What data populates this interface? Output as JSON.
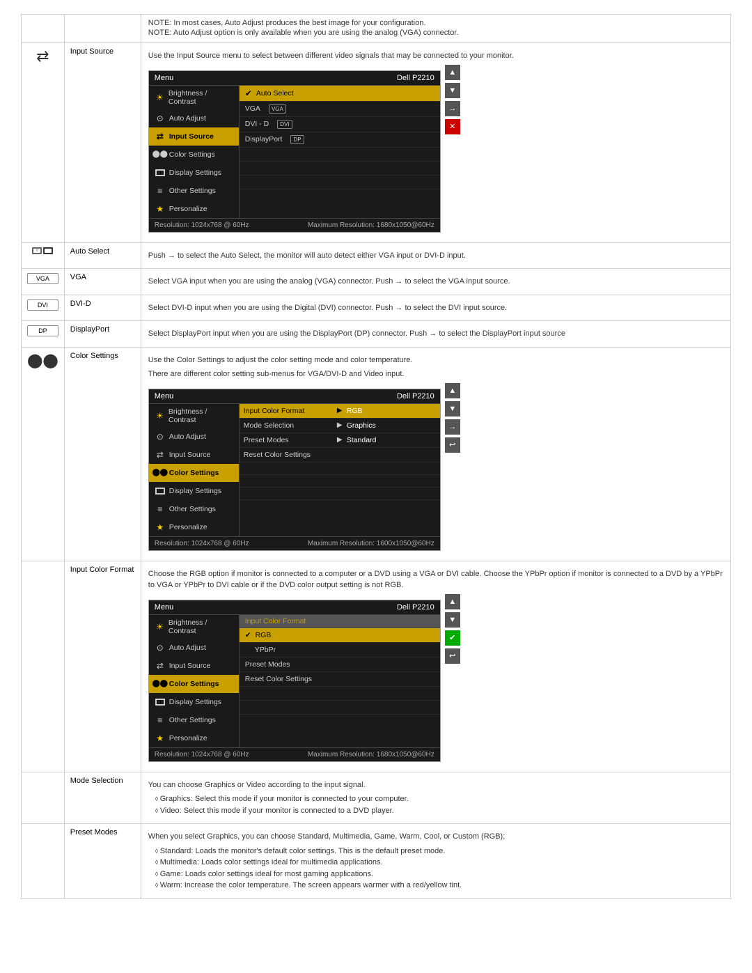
{
  "notes": {
    "note1": "NOTE: In most cases, Auto Adjust produces the best image for your configuration.",
    "note2": "NOTE: Auto Adjust option is only available when you are using the analog (VGA) connector."
  },
  "inputSource": {
    "label": "Input Source",
    "description": "Use the Input Source menu to select between different video signals that may be connected to your monitor.",
    "osd1": {
      "menuLabel": "Menu",
      "brandLabel": "Dell P2210",
      "items": [
        {
          "icon": "☀",
          "label": "Brightness / Contrast"
        },
        {
          "icon": "⊙",
          "label": "Auto Adjust"
        },
        {
          "icon": "⇄",
          "label": "Input Source",
          "active": true
        },
        {
          "icon": "⬤⬤",
          "label": "Color Settings"
        },
        {
          "icon": "▭",
          "label": "Display Settings"
        },
        {
          "icon": "≡",
          "label": "Other Settings"
        },
        {
          "icon": "★",
          "label": "Personalize"
        }
      ],
      "rightItems": [
        {
          "label": "Auto Select",
          "check": "✔",
          "checked": true
        },
        {
          "label": "VGA",
          "connector": "VGA"
        },
        {
          "label": "DVI - D",
          "connector": "DVI"
        },
        {
          "label": "DisplayPort",
          "connector": "DP"
        }
      ],
      "footer": {
        "left": "Resolution: 1024x768 @ 60Hz",
        "right": "Maximum Resolution: 1680x1050@60Hz"
      }
    },
    "navButtons": [
      "▲",
      "▼",
      "→",
      "✕"
    ],
    "navColors": [
      "gray",
      "gray",
      "gray",
      "red"
    ]
  },
  "autoSelect": {
    "label": "Auto Select",
    "description": "Push → to select the Auto Select, the monitor will auto detect either VGA input or DVI-D input."
  },
  "vga": {
    "label": "VGA",
    "description": "Select VGA input when you are using the analog (VGA) connector. Push → to select the VGA input source."
  },
  "dviD": {
    "label": "DVI-D",
    "description": "Select DVI-D input when you are using the Digital (DVI) connector. Push → to select the DVI input source."
  },
  "displayPort": {
    "label": "DisplayPort",
    "description": "Select DisplayPort input when you are using the DisplayPort (DP) connector. Push → to select the DisplayPort input source"
  },
  "colorSettings": {
    "label": "Color Settings",
    "desc1": "Use the Color Settings to adjust the color setting mode and color temperature.",
    "desc2": "There are different color setting sub-menus for VGA/DVI-D and Video input.",
    "osd": {
      "menuLabel": "Menu",
      "brandLabel": "Dell P2210",
      "items": [
        {
          "icon": "☀",
          "label": "Brightness / Contrast"
        },
        {
          "icon": "⊙",
          "label": "Auto Adjust"
        },
        {
          "icon": "⇄",
          "label": "Input Source"
        },
        {
          "icon": "⬤⬤",
          "label": "Color Settings",
          "active": true
        },
        {
          "icon": "▭",
          "label": "Display Settings"
        },
        {
          "icon": "≡",
          "label": "Other Settings"
        },
        {
          "icon": "★",
          "label": "Personalize"
        }
      ],
      "rightRows": [
        {
          "label": "Input Color Format",
          "hasArrow": true,
          "value": "RGB",
          "highlighted": true
        },
        {
          "label": "Mode Selection",
          "hasArrow": true,
          "value": "Graphics"
        },
        {
          "label": "Preset Modes",
          "hasArrow": true,
          "value": "Standard"
        },
        {
          "label": "Reset Color Settings",
          "hasArrow": false,
          "value": ""
        }
      ],
      "footer": {
        "left": "Resolution: 1024x768 @ 60Hz",
        "right": "Maximum Resolution: 1600x1050@60Hz"
      }
    },
    "navButtons": [
      "▲",
      "▼",
      "→",
      "↩"
    ],
    "navColors": [
      "gray",
      "gray",
      "gray",
      "gray"
    ]
  },
  "inputColorFormat": {
    "label": "Input Color Format",
    "desc": "Choose the RGB option if monitor is connected to a computer or a DVD using a VGA or DVI cable. Choose the YPbPr option if monitor is connected to a DVD by a YPbPr to VGA or YPbPr to DVI cable or if the DVD color output setting is not RGB.",
    "osd": {
      "menuLabel": "Menu",
      "brandLabel": "Dell P2210",
      "items": [
        {
          "icon": "☀",
          "label": "Brightness / Contrast"
        },
        {
          "icon": "⊙",
          "label": "Auto Adjust"
        },
        {
          "icon": "⇄",
          "label": "Input Source"
        },
        {
          "icon": "⬤⬤",
          "label": "Color Settings",
          "active": true
        },
        {
          "icon": "▭",
          "label": "Display Settings"
        },
        {
          "icon": "≡",
          "label": "Other Settings"
        },
        {
          "icon": "★",
          "label": "Personalize"
        }
      ],
      "rightSubLabel": "Input Color Format",
      "rightItems": [
        {
          "label": "RGB",
          "check": "✔",
          "checked": true,
          "highlighted": true
        },
        {
          "label": "YPbPr",
          "checked": false
        }
      ],
      "bottomRows": [
        {
          "label": "Preset Modes"
        },
        {
          "label": "Reset Color Settings"
        }
      ],
      "footer": {
        "left": "Resolution: 1024x768 @ 60Hz",
        "right": "Maximum Resolution: 1680x1050@60Hz"
      }
    },
    "navButtons": [
      "▲",
      "▼",
      "✔",
      "↩"
    ],
    "navColors": [
      "gray",
      "gray",
      "green",
      "gray"
    ]
  },
  "modeSelection": {
    "label": "Mode Selection",
    "desc": "You can choose Graphics or Video according to the input signal.",
    "items": [
      "Graphics: Select this mode if your monitor is connected to your computer.",
      "Video: Select this mode if your monitor is connected to a DVD player."
    ]
  },
  "presetModes": {
    "label": "Preset Modes",
    "desc": "When you select Graphics, you can choose Standard, Multimedia, Game, Warm, Cool, or Custom (RGB);",
    "items": [
      "Standard: Loads the monitor's default color settings. This is the default preset mode.",
      "Multimedia: Loads color settings ideal for multimedia applications.",
      "Game: Loads color settings ideal for most gaming applications.",
      "Warm: Increase the color temperature. The screen appears warmer with a red/yellow tint."
    ]
  },
  "osdMenuItems": {
    "brightnessContrast": "Brightness / Contrast",
    "autoAdjust": "Auto Adjust",
    "inputSource": "Input Source",
    "colorSettings": "Color Settings",
    "displaySettings": "Display Settings",
    "otherSettings": "Other Settings",
    "personalize": "Personalize"
  }
}
